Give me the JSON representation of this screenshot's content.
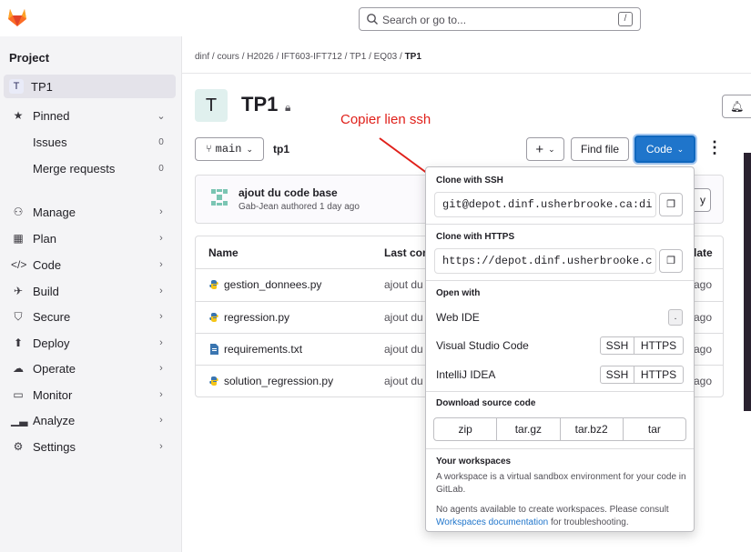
{
  "search": {
    "placeholder": "Search or go to...",
    "shortcut": "/"
  },
  "sidebar": {
    "heading": "Project",
    "project": {
      "avatar": "T",
      "label": "TP1"
    },
    "pinned": "Pinned",
    "issues": {
      "label": "Issues",
      "count": "0"
    },
    "merge_requests": {
      "label": "Merge requests",
      "count": "0"
    },
    "items": [
      {
        "label": "Manage",
        "icon": "users-icon"
      },
      {
        "label": "Plan",
        "icon": "calendar-icon"
      },
      {
        "label": "Code",
        "icon": "code-icon"
      },
      {
        "label": "Build",
        "icon": "rocket-icon"
      },
      {
        "label": "Secure",
        "icon": "shield-icon"
      },
      {
        "label": "Deploy",
        "icon": "deploy-icon"
      },
      {
        "label": "Operate",
        "icon": "cloud-icon"
      },
      {
        "label": "Monitor",
        "icon": "monitor-icon"
      },
      {
        "label": "Analyze",
        "icon": "chart-icon"
      },
      {
        "label": "Settings",
        "icon": "gear-icon"
      }
    ]
  },
  "breadcrumb": {
    "parts": [
      "dinf",
      "cours",
      "H2026",
      "IFT603-IFT712",
      "TP1",
      "EQ03"
    ],
    "current": "TP1",
    "sep": "/"
  },
  "project": {
    "avatar": "T",
    "title": "TP1"
  },
  "annotation": "Copier lien ssh",
  "toolbar": {
    "branch": "main",
    "repo": "tp1",
    "plus": "+",
    "find_file": "Find file",
    "code": "Code",
    "history_suffix": "y"
  },
  "commit": {
    "title": "ajout du code base",
    "meta": "Gab-Jean authored 1 day ago"
  },
  "table": {
    "headers": {
      "name": "Name",
      "last_commit": "Last com",
      "date": "late"
    },
    "rows": [
      {
        "name": "gestion_donnees.py",
        "commit": "ajout du",
        "date": "ago",
        "type": "python"
      },
      {
        "name": "regression.py",
        "commit": "ajout du",
        "date": "ago",
        "type": "python"
      },
      {
        "name": "requirements.txt",
        "commit": "ajout du",
        "date": "ago",
        "type": "text"
      },
      {
        "name": "solution_regression.py",
        "commit": "ajout du",
        "date": "ago",
        "type": "python"
      }
    ]
  },
  "dropdown": {
    "ssh_label": "Clone with SSH",
    "ssh_url": "git@depot.dinf.usherbrooke.ca:di",
    "https_label": "Clone with HTTPS",
    "https_url": "https://depot.dinf.usherbrooke.c",
    "open_with": "Open with",
    "web_ide": "Web IDE",
    "web_ide_key": ".",
    "vscode": "Visual Studio Code",
    "intellij": "IntelliJ IDEA",
    "ssh_btn": "SSH",
    "https_btn": "HTTPS",
    "download_label": "Download source code",
    "formats": [
      "zip",
      "tar.gz",
      "tar.bz2",
      "tar"
    ],
    "workspaces_label": "Your workspaces",
    "workspaces_desc": "A workspace is a virtual sandbox environment for your code in GitLab.",
    "workspaces_note_pre": "No agents available to create workspaces. Please consult ",
    "workspaces_link": "Workspaces documentation",
    "workspaces_note_post": " for troubleshooting."
  },
  "colors": {
    "primary": "#1f75cb",
    "annotation": "#e0201a",
    "logo": "#e24329"
  }
}
